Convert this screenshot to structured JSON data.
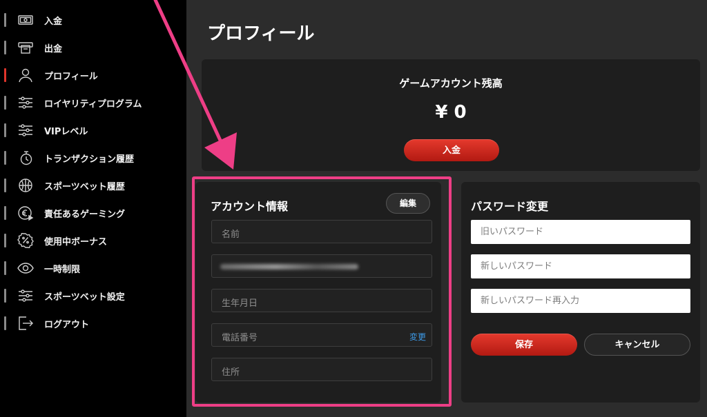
{
  "sidebar": {
    "items": [
      {
        "label": "入金",
        "icon": "cash-icon",
        "active": false
      },
      {
        "label": "出金",
        "icon": "atm-withdraw-icon",
        "active": false
      },
      {
        "label": "プロフィール",
        "icon": "user-icon",
        "active": true
      },
      {
        "label": "ロイヤリティプログラム",
        "icon": "sliders-icon",
        "active": false
      },
      {
        "label": "VIPレベル",
        "icon": "sliders-icon",
        "active": false
      },
      {
        "label": "トランザクション履歴",
        "icon": "timer-icon",
        "active": false
      },
      {
        "label": "スポーツベット履歴",
        "icon": "ball-icon",
        "active": false
      },
      {
        "label": "責任あるゲーミング",
        "icon": "euro-play-icon",
        "active": false
      },
      {
        "label": "使用中ボーナス",
        "icon": "percent-badge-icon",
        "active": false
      },
      {
        "label": "一時制限",
        "icon": "eye-icon",
        "active": false
      },
      {
        "label": "スポーツベット設定",
        "icon": "sliders-icon",
        "active": false
      },
      {
        "label": "ログアウト",
        "icon": "logout-icon",
        "active": false
      }
    ]
  },
  "main": {
    "title": "プロフィール",
    "balance": {
      "title": "ゲームアカウント残高",
      "amount": "¥ 0",
      "deposit_label": "入金"
    },
    "account": {
      "heading": "アカウント情報",
      "edit_label": "編集",
      "fields": {
        "name": "名前",
        "birthdate": "生年月日",
        "phone": "電話番号",
        "address": "住所"
      },
      "change_label": "変更"
    },
    "password": {
      "heading": "パスワード変更",
      "old_placeholder": "旧いパスワード",
      "new_placeholder": "新しいパスワード",
      "confirm_placeholder": "新しいパスワード再入力",
      "save_label": "保存",
      "cancel_label": "キャンセル"
    }
  },
  "colors": {
    "accent_red": "#d62a1f",
    "highlight_pink": "#ee3e86",
    "link_blue": "#3d9be9"
  }
}
